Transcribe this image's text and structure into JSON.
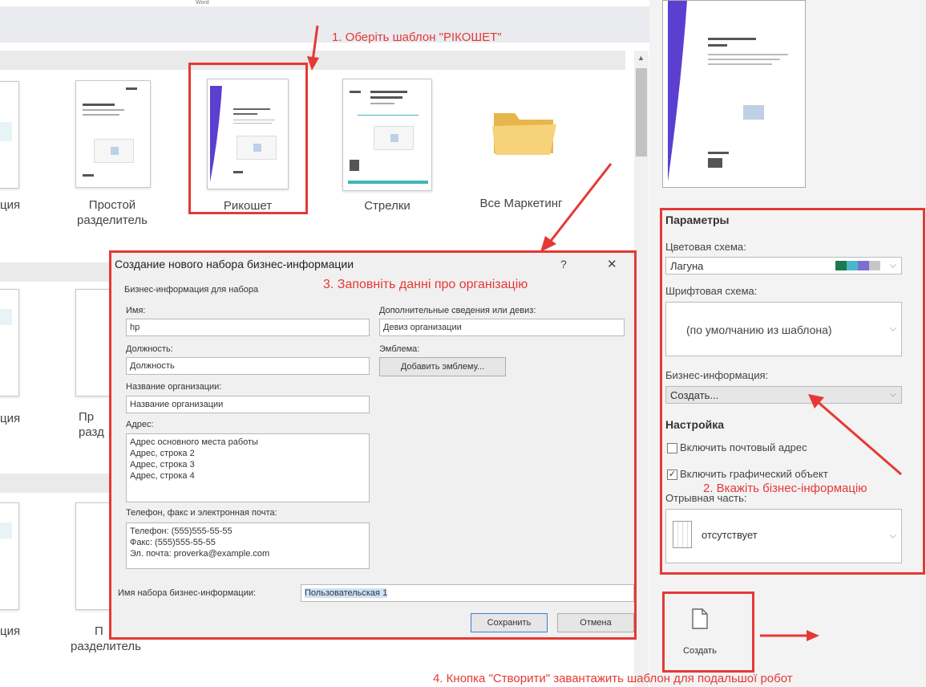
{
  "app": {
    "word_label": "Word"
  },
  "gallery": {
    "items": [
      {
        "label_line1": "Простой",
        "label_line2": "разделитель"
      },
      {
        "label": "Рикошет"
      },
      {
        "label": "Стрелки"
      },
      {
        "label": "Все Маркетинг"
      }
    ],
    "partial_label": "ция",
    "partial_label_row2": "ция",
    "partial_label_row3": "ция",
    "row2_partial_label_line1": "Пр",
    "row2_partial_label_line2": "разд",
    "row3_partial_label_line1": "П",
    "row3_partial_label_line2": "разделитель"
  },
  "annotations": {
    "step1": "1. Оберіть шаблон \"РІКОШЕТ\"",
    "step2": "2. Вкажіть бізнес-інформацію",
    "step3": "3. Заповніть данні про організацію",
    "step4": "4. Кнопка \"Створити\" завантажить шаблон для подальшої робот"
  },
  "dialog": {
    "title": "Создание нового набора бизнес-информации",
    "help": "?",
    "close": "✕",
    "group_label": "Бизнес-информация для набора",
    "name_label": "Имя:",
    "name_value": "hp",
    "position_label": "Должность:",
    "position_value": "Должность",
    "org_label": "Название организации:",
    "org_value": "Название организации",
    "address_label": "Адрес:",
    "address_lines": [
      "Адрес основного места работы",
      "Адрес, строка 2",
      "Адрес, строка 3",
      "Адрес, строка 4"
    ],
    "phone_label": "Телефон, факс и электронная почта:",
    "phone_lines": [
      "Телефон: (555)555-55-55",
      "Факс: (555)555-55-55",
      "Эл. почта: proverka@example.com"
    ],
    "motto_label": "Дополнительные сведения или девиз:",
    "motto_value": "Девиз организации",
    "emblem_label": "Эмблема:",
    "emblem_button": "Добавить эмблему...",
    "set_name_label": "Имя набора бизнес-информации:",
    "set_name_value": "Пользовательская 1",
    "save_button": "Сохранить",
    "cancel_button": "Отмена"
  },
  "params": {
    "title": "Параметры",
    "color_scheme_label": "Цветовая схема:",
    "color_scheme_value": "Лагуна",
    "swatches": [
      "#1e7a4c",
      "#49b7c9",
      "#7a6fd1",
      "#c6c6c6"
    ],
    "font_scheme_label": "Шрифтовая схема:",
    "font_scheme_value": "(по умолчанию из шаблона)",
    "business_label": "Бизнес-информация:",
    "business_value": "Создать...",
    "settings_title": "Настройка",
    "include_mail": "Включить почтовый адрес",
    "include_graphic": "Включить графический объект",
    "tearoff_label": "Отрывная часть:",
    "tearoff_value": "отсутствует"
  },
  "create": {
    "label": "Создать"
  },
  "colors": {
    "accent_red": "#e53935",
    "ricochet_purple": "#5a3fd1"
  }
}
